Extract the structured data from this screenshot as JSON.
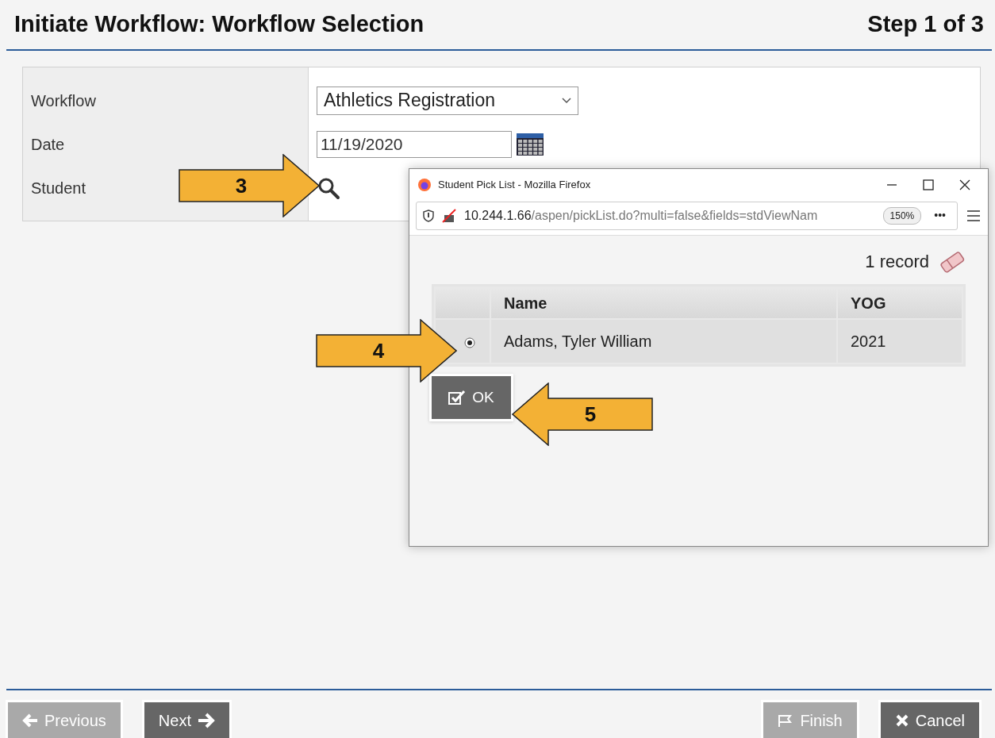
{
  "header": {
    "title": "Initiate Workflow: Workflow Selection",
    "step": "Step 1 of 3"
  },
  "form": {
    "fields": [
      {
        "kind": "select",
        "label": "Workflow",
        "value": "Athletics Registration"
      },
      {
        "kind": "date",
        "label": "Date",
        "value": "11/19/2020"
      },
      {
        "kind": "lookup",
        "label": "Student"
      }
    ]
  },
  "popup": {
    "title": "Student Pick List - Mozilla Firefox",
    "url_host": "10.244.1.66",
    "url_path": "/aspen/pickList.do?multi=false&fields=stdViewNam",
    "zoom": "150%",
    "more": "•••",
    "record_count": "1 record",
    "columns": [
      "Name",
      "YOG"
    ],
    "rows": [
      {
        "selected": true,
        "name": "Adams, Tyler William",
        "yog": "2021"
      }
    ],
    "ok_button": "OK"
  },
  "callouts": [
    {
      "label": "3",
      "kind": "right"
    },
    {
      "label": "4",
      "kind": "right"
    },
    {
      "label": "5",
      "kind": "left"
    }
  ],
  "buttons": [
    {
      "kind": "previous",
      "label": "Previous",
      "disabled": true
    },
    {
      "kind": "next",
      "label": "Next",
      "disabled": false
    },
    {
      "kind": "finish",
      "label": "Finish",
      "disabled": true
    },
    {
      "kind": "cancel",
      "label": "Cancel",
      "disabled": false
    }
  ]
}
